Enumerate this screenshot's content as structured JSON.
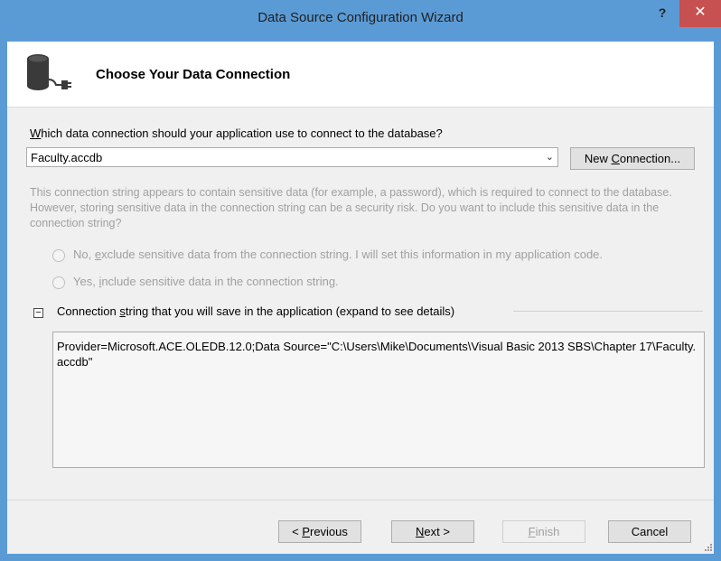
{
  "window": {
    "title": "Data Source Configuration Wizard",
    "help_label": "?",
    "close_label": "✕"
  },
  "header": {
    "title": "Choose Your Data Connection",
    "icon": "database-plug-icon"
  },
  "connection": {
    "question_accel": "W",
    "question_rest": "hich data connection should your application use to connect to the database?",
    "selected": "Faculty.accdb",
    "dropdown_arrow": "⌄",
    "new_button_pre": "New ",
    "new_button_accel": "C",
    "new_button_post": "onnection..."
  },
  "sensitive": {
    "notice": "This connection string appears to contain sensitive data (for example, a password), which is required to connect to the database. However, storing sensitive data in the connection string can be a security risk. Do you want to include this sensitive data in the connection string?",
    "option_no_pre": "No, ",
    "option_no_accel": "e",
    "option_no_post": "xclude sensitive data from the connection string. I will set this information in my application code.",
    "option_yes_pre": "Yes, ",
    "option_yes_accel": "i",
    "option_yes_post": "nclude sensitive data in the connection string."
  },
  "details": {
    "expander": "−",
    "label_pre": "Connection ",
    "label_accel": "s",
    "label_post": "tring that you will save in the application (expand to see details)",
    "connection_string": "Provider=Microsoft.ACE.OLEDB.12.0;Data Source=\"C:\\Users\\Mike\\Documents\\Visual Basic 2013 SBS\\Chapter 17\\Faculty.accdb\""
  },
  "buttons": {
    "previous_pre": "< ",
    "previous_accel": "P",
    "previous_post": "revious",
    "next_accel": "N",
    "next_post": "ext >",
    "finish_accel": "F",
    "finish_post": "inish",
    "cancel": "Cancel"
  }
}
